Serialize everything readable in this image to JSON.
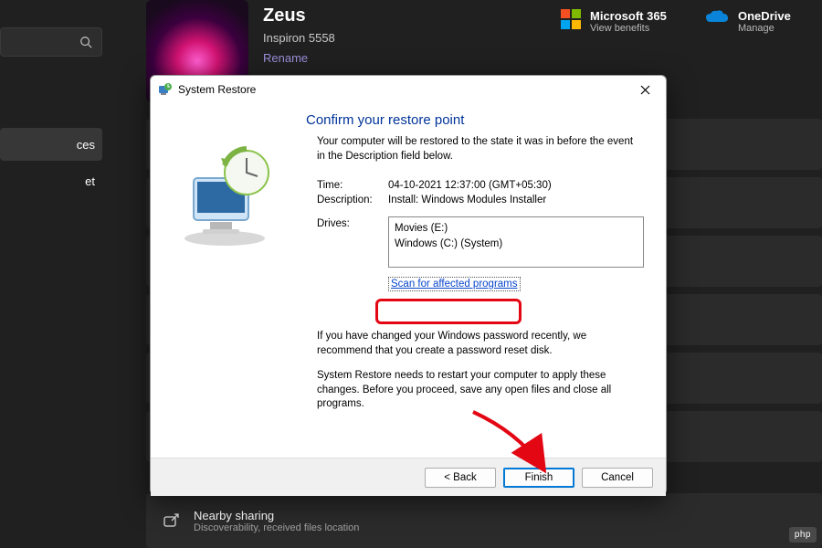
{
  "sidebar": {
    "searchPlaceholder": "",
    "items": [
      "",
      "ces",
      "et"
    ]
  },
  "profile": {
    "name": "Zeus",
    "model": "Inspiron 5558",
    "renameLabel": "Rename"
  },
  "topLinks": {
    "ms365": {
      "title": "Microsoft 365",
      "sub": "View benefits"
    },
    "onedrive": {
      "title": "OneDrive",
      "sub": "Manage"
    }
  },
  "nearby": {
    "title": "Nearby sharing",
    "sub": "Discoverability, received files location"
  },
  "dialog": {
    "title": "System Restore",
    "heading": "Confirm your restore point",
    "intro": "Your computer will be restored to the state it was in before the event in the Description field below.",
    "timeLabel": "Time:",
    "timeValue": "04-10-2021 12:37:00 (GMT+05:30)",
    "descLabel": "Description:",
    "descValue": "Install: Windows Modules Installer",
    "drivesLabel": "Drives:",
    "drives": {
      "line1": "Movies (E:)",
      "line2": "Windows (C:) (System)"
    },
    "scanLink": "Scan for affected programs",
    "note1": "If you have changed your Windows password recently, we recommend that you create a password reset disk.",
    "note2": "System Restore needs to restart your computer to apply these changes. Before you proceed, save any open files and close all programs.",
    "buttons": {
      "back": "< Back",
      "finish": "Finish",
      "cancel": "Cancel"
    }
  },
  "watermark": "php"
}
